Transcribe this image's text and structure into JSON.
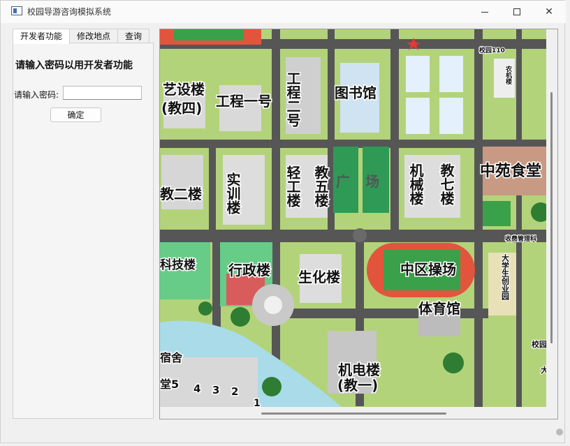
{
  "window": {
    "title": "校园导游咨询模拟系统",
    "controls": {
      "minimize": "minimize-icon",
      "maximize": "maximize-icon",
      "close": "✕"
    }
  },
  "tabs": [
    {
      "label": "开发者功能",
      "active": true
    },
    {
      "label": "修改地点",
      "active": false
    },
    {
      "label": "查询",
      "active": false
    }
  ],
  "developer_panel": {
    "heading": "请输入密码以用开发者功能",
    "password_label": "请输入密码:",
    "password_value": "",
    "confirm_label": "确定"
  },
  "map": {
    "labels": {
      "art_building": "艺设楼",
      "art_building_sub": "(教四)",
      "engineering_one": "工程一号",
      "engineering_two": "工程二号",
      "library": "图书馆",
      "gate_110": "校园110",
      "agri_building": "农机楼",
      "teaching_two": "教二楼",
      "training_building": "实训楼",
      "light_industry": "轻工楼",
      "teaching_five": "教五楼",
      "plaza": "广场",
      "mechanical_building": "机械楼",
      "teaching_seven": "教七楼",
      "zhongyuan_canteen": "中苑食堂",
      "science_tech": "科技楼",
      "admin_building": "行政楼",
      "biochem_building": "生化楼",
      "central_field": "中区操场",
      "fee_office": "收费管理科",
      "startup_park": "大学生创业园",
      "gym": "体育馆",
      "dorm": "宿舍",
      "mechatronics": "机电楼",
      "mechatronics_sub": "(教一)",
      "canteen_five": "堂5",
      "n4": "4",
      "n3": "3",
      "n2": "2",
      "n1": "1",
      "gate_right": "校园",
      "partial_right": "大"
    },
    "colors": {
      "grass": "#b3d37a",
      "road": "#565656",
      "water": "#a9dbe9",
      "track": "#e2553c",
      "field": "#3aa04a",
      "plaza": "#2f9a56",
      "tree": "#2e7d32"
    }
  }
}
